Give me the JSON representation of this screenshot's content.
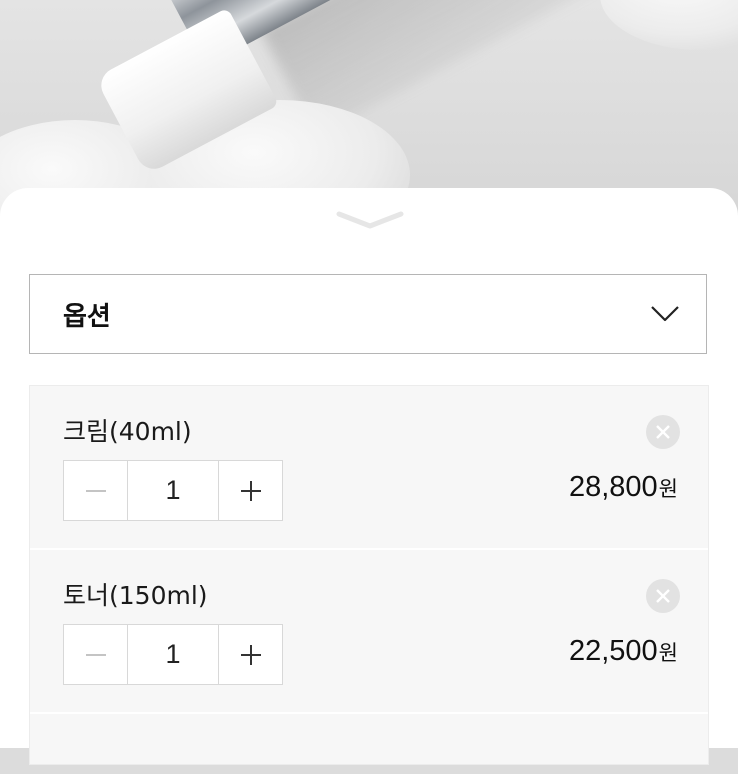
{
  "option_select": {
    "label": "옵션",
    "icon": "chevron-down-icon"
  },
  "items": [
    {
      "name": "크림(40ml)",
      "quantity": "1",
      "price": "28,800",
      "currency": "원"
    },
    {
      "name": "토너(150ml)",
      "quantity": "1",
      "price": "22,500",
      "currency": "원"
    }
  ],
  "colors": {
    "brand_green": "#39b54a",
    "sheet_bg": "#ffffff",
    "panel_bg": "#f7f7f7",
    "border": "#b5b5b5"
  }
}
